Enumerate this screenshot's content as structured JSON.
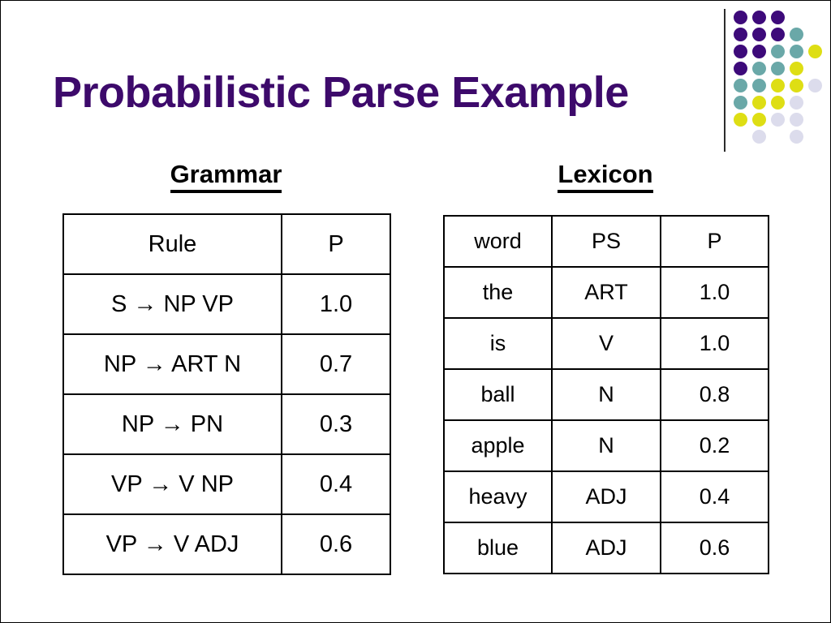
{
  "slide": {
    "title": "Probabilistic Parse Example",
    "title_color": "#3d0a6b",
    "background_color": "#ffffff"
  },
  "sections": {
    "grammar_heading": "Grammar",
    "lexicon_heading": "Lexicon"
  },
  "grammar_table": {
    "headers": [
      "Rule",
      "P"
    ],
    "rows": [
      {
        "rule": "S → NP VP",
        "p": "1.0"
      },
      {
        "rule": "NP → ART N",
        "p": "0.7"
      },
      {
        "rule": "NP → PN",
        "p": "0.3"
      },
      {
        "rule": "VP → V NP",
        "p": "0.4"
      },
      {
        "rule": "VP → V ADJ",
        "p": "0.6"
      }
    ]
  },
  "lexicon_table": {
    "headers": [
      "word",
      "PS",
      "P"
    ],
    "rows": [
      {
        "word": "the",
        "ps": "ART",
        "p": "1.0"
      },
      {
        "word": "is",
        "ps": "V",
        "p": "1.0"
      },
      {
        "word": "ball",
        "ps": "N",
        "p": "0.8"
      },
      {
        "word": "apple",
        "ps": "N",
        "p": "0.2"
      },
      {
        "word": "heavy",
        "ps": "ADJ",
        "p": "0.4"
      },
      {
        "word": "blue",
        "ps": "ADJ",
        "p": "0.6"
      }
    ]
  },
  "decoration": {
    "name": "dot-matrix-motif",
    "rule_color": "#2b2b2b",
    "colors": {
      "purple": "#3d0a7a",
      "teal": "#6aa8a8",
      "yellow": "#dede14",
      "lavender": "#dcdcec"
    },
    "dots": [
      {
        "row": 0,
        "col": 0,
        "color": "purple"
      },
      {
        "row": 0,
        "col": 1,
        "color": "purple"
      },
      {
        "row": 0,
        "col": 2,
        "color": "purple"
      },
      {
        "row": 1,
        "col": 0,
        "color": "purple"
      },
      {
        "row": 1,
        "col": 1,
        "color": "purple"
      },
      {
        "row": 1,
        "col": 2,
        "color": "purple"
      },
      {
        "row": 1,
        "col": 3,
        "color": "teal"
      },
      {
        "row": 2,
        "col": 0,
        "color": "purple"
      },
      {
        "row": 2,
        "col": 1,
        "color": "purple"
      },
      {
        "row": 2,
        "col": 2,
        "color": "teal"
      },
      {
        "row": 2,
        "col": 3,
        "color": "teal"
      },
      {
        "row": 2,
        "col": 4,
        "color": "yellow"
      },
      {
        "row": 3,
        "col": 0,
        "color": "purple"
      },
      {
        "row": 3,
        "col": 1,
        "color": "teal"
      },
      {
        "row": 3,
        "col": 2,
        "color": "teal"
      },
      {
        "row": 3,
        "col": 3,
        "color": "yellow"
      },
      {
        "row": 4,
        "col": 0,
        "color": "teal"
      },
      {
        "row": 4,
        "col": 1,
        "color": "teal"
      },
      {
        "row": 4,
        "col": 2,
        "color": "yellow"
      },
      {
        "row": 4,
        "col": 3,
        "color": "yellow"
      },
      {
        "row": 4,
        "col": 4,
        "color": "lavender"
      },
      {
        "row": 5,
        "col": 0,
        "color": "teal"
      },
      {
        "row": 5,
        "col": 1,
        "color": "yellow"
      },
      {
        "row": 5,
        "col": 2,
        "color": "yellow"
      },
      {
        "row": 5,
        "col": 3,
        "color": "lavender"
      },
      {
        "row": 6,
        "col": 0,
        "color": "yellow"
      },
      {
        "row": 6,
        "col": 1,
        "color": "yellow"
      },
      {
        "row": 6,
        "col": 2,
        "color": "lavender"
      },
      {
        "row": 6,
        "col": 3,
        "color": "lavender"
      },
      {
        "row": 7,
        "col": 1,
        "color": "lavender"
      },
      {
        "row": 7,
        "col": 3,
        "color": "lavender"
      }
    ]
  }
}
